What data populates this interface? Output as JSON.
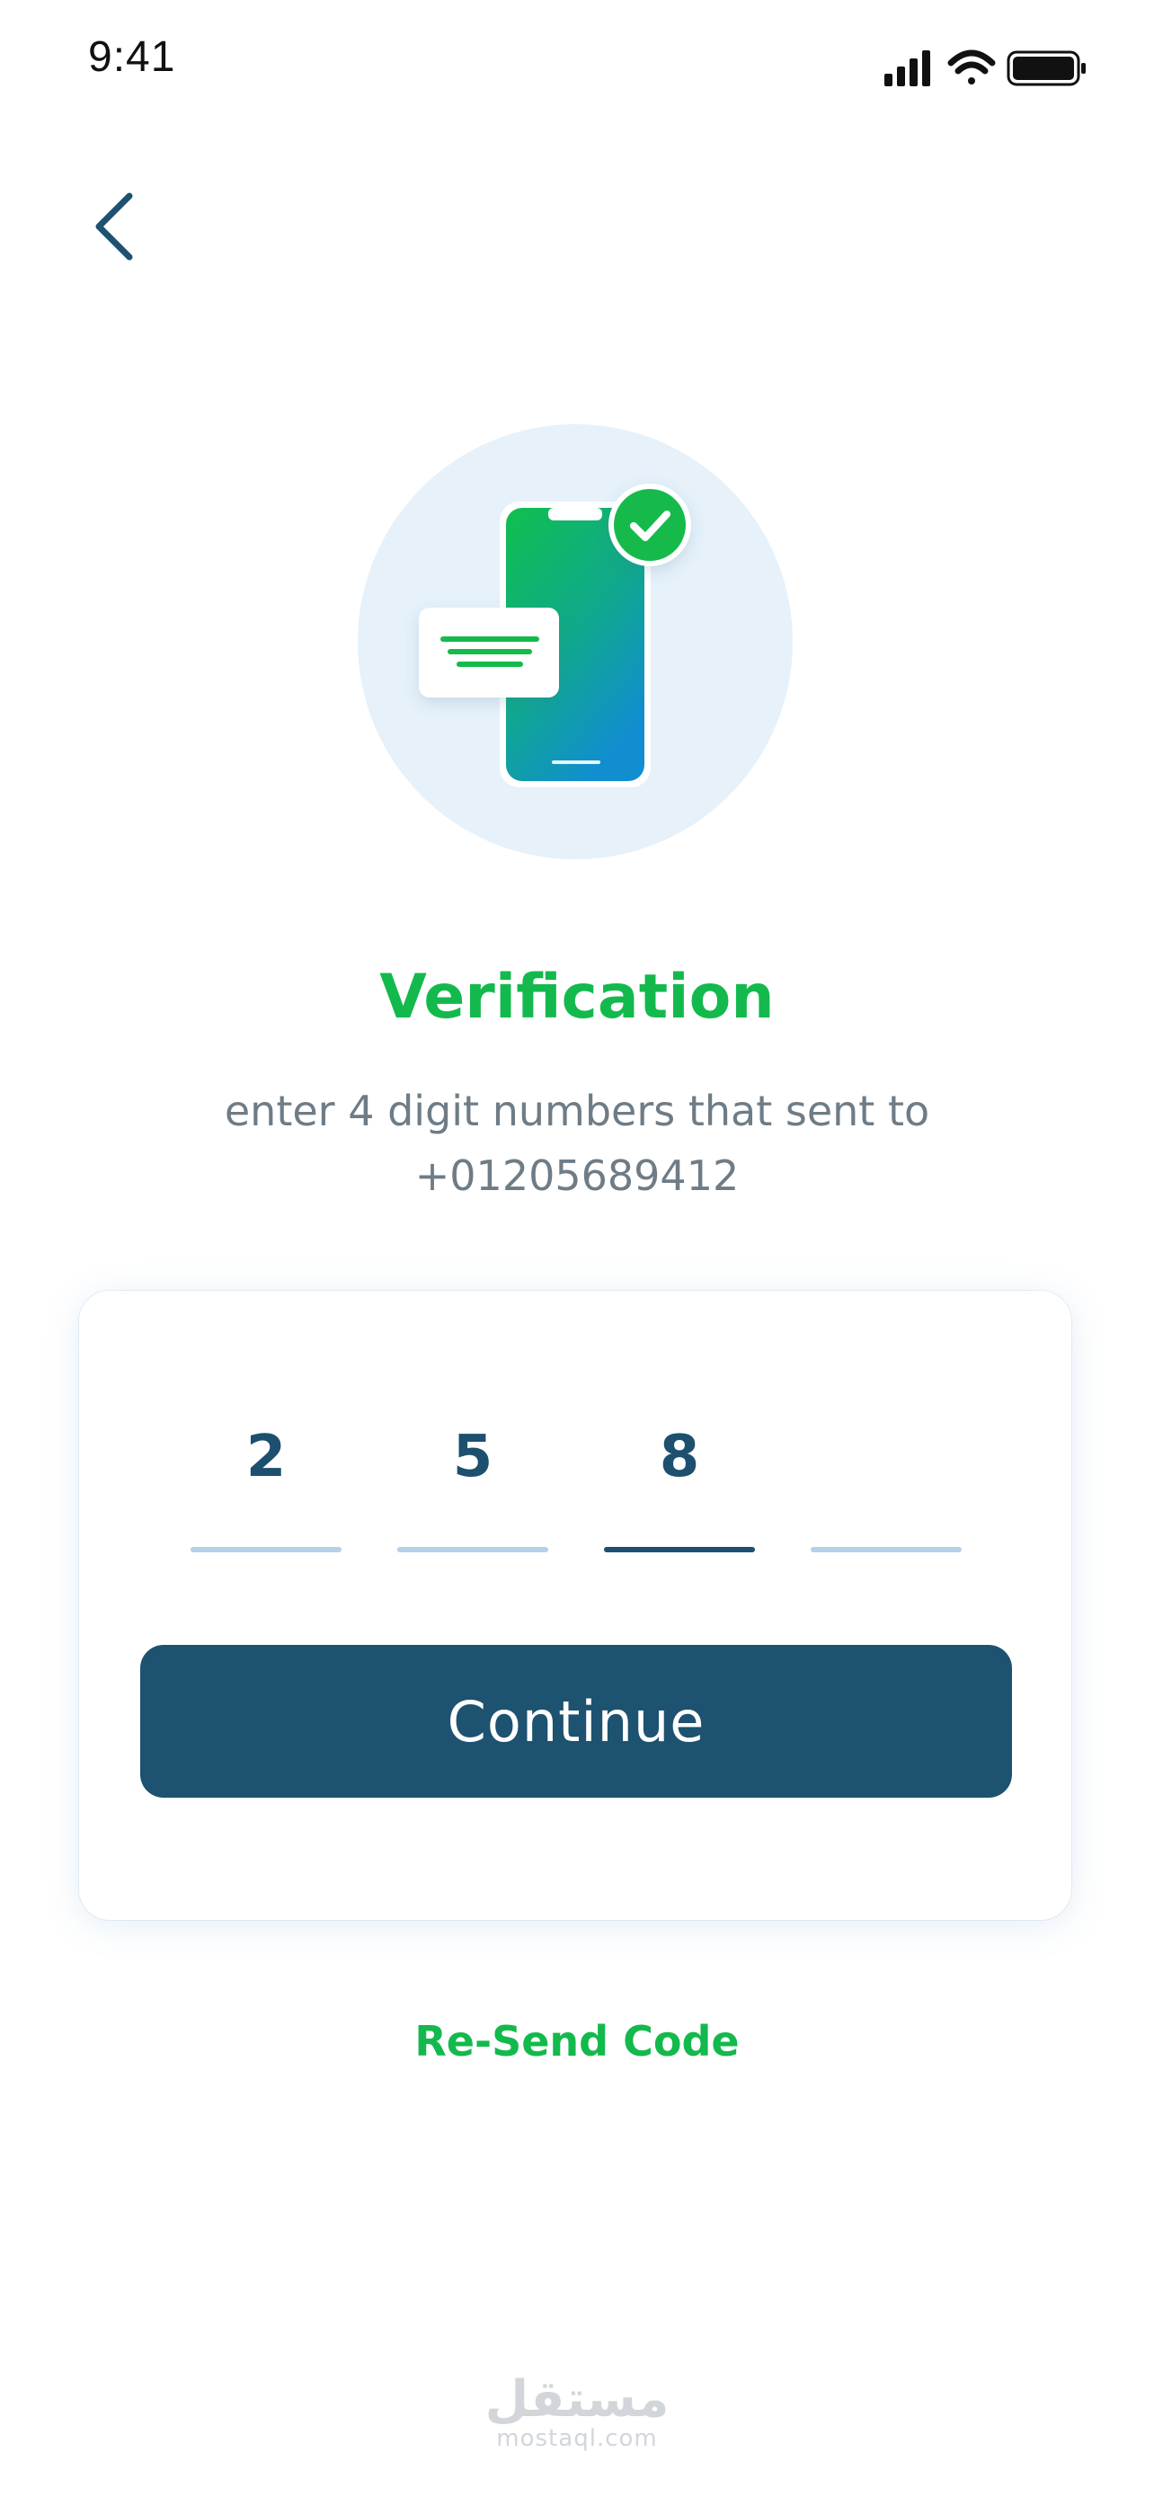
{
  "status_bar": {
    "time": "9:41"
  },
  "header": {
    "back_icon": "chevron-left-icon"
  },
  "illustration": {
    "icons": [
      "phone-icon",
      "check-badge-icon",
      "message-card-icon"
    ]
  },
  "content": {
    "title": "Verification",
    "subtitle_line1": "enter 4 digit numbers that sent to",
    "subtitle_line2": "+01205689412"
  },
  "otp": {
    "digits": [
      "2",
      "5",
      "8",
      ""
    ],
    "active_index": 2
  },
  "actions": {
    "continue_label": "Continue",
    "resend_label": "Re-Send Code"
  },
  "watermark": {
    "arabic": "مستقل",
    "latin": "mostaql.com"
  },
  "colors": {
    "accent_green": "#13b94c",
    "primary_blue": "#1d5270",
    "text_gray": "#6e7c86",
    "otp_line_inactive": "#b6cfea"
  }
}
